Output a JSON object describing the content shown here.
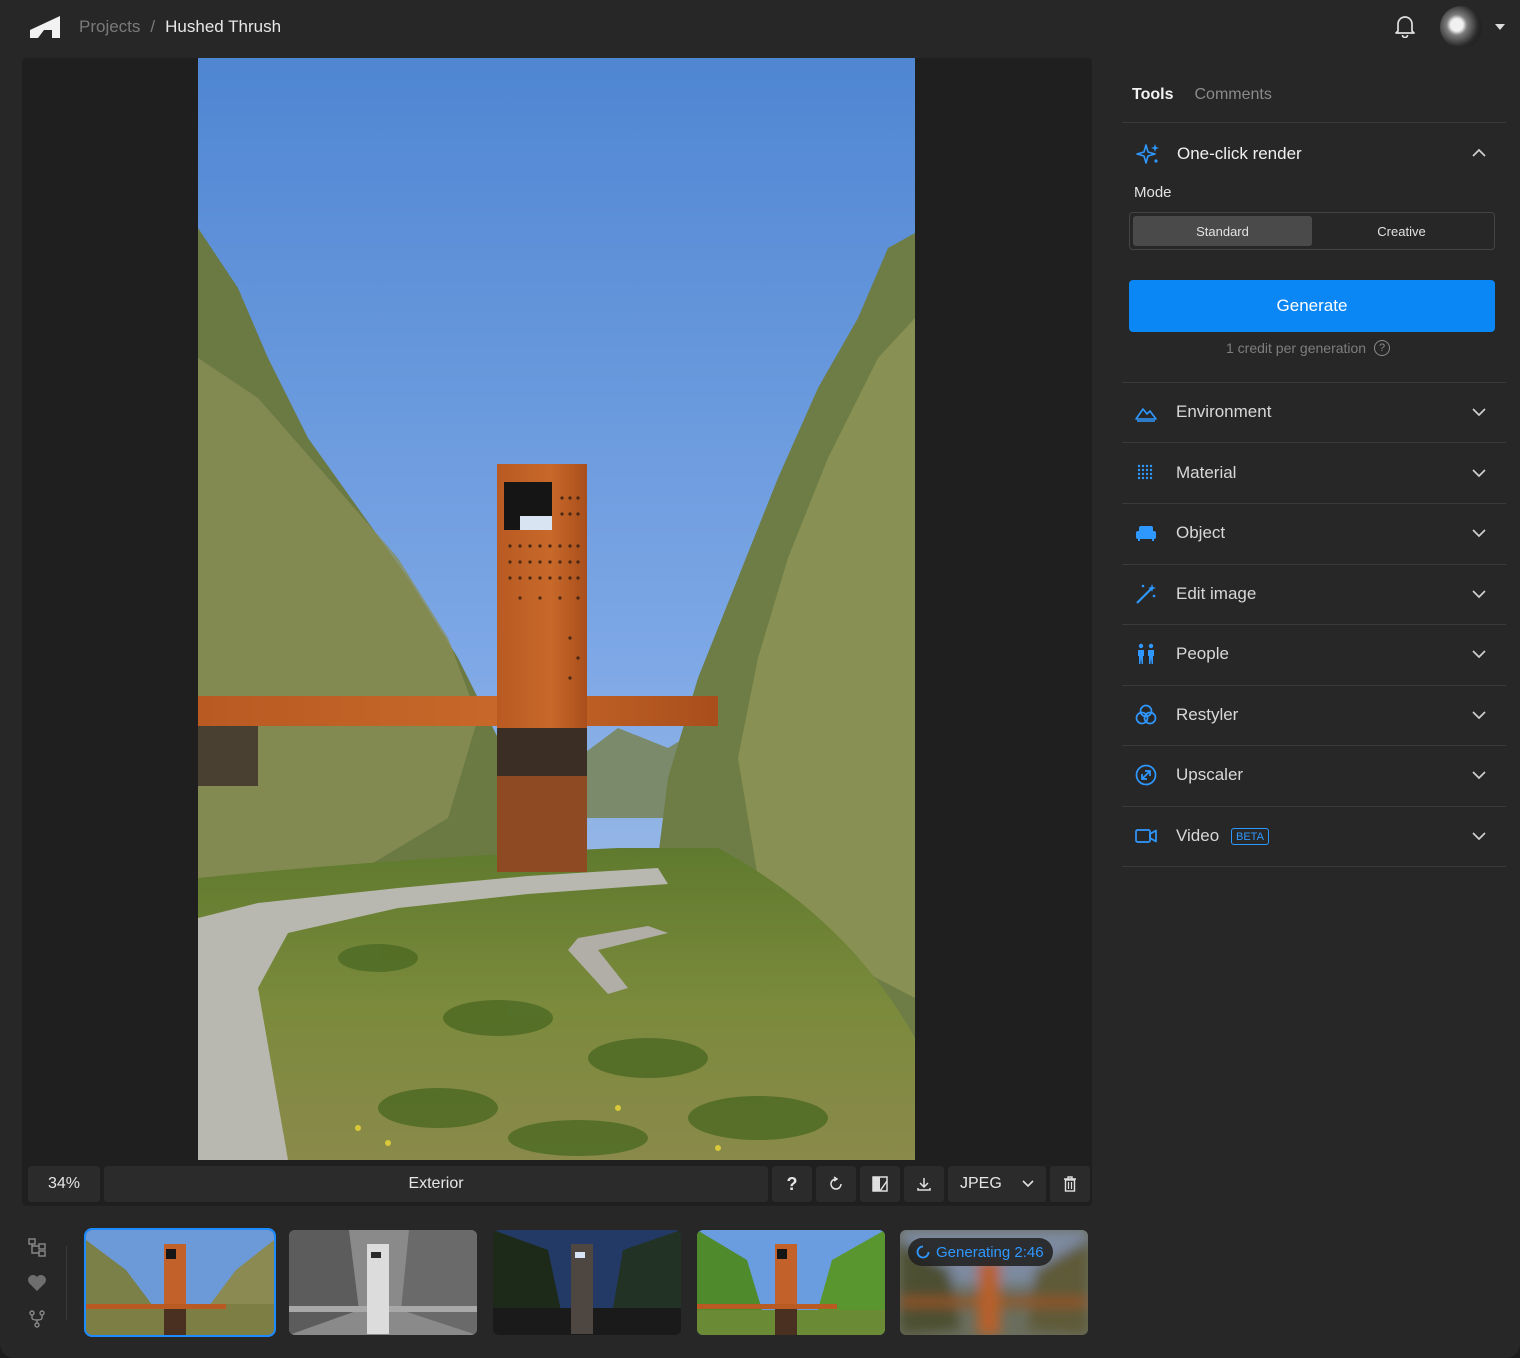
{
  "header": {
    "breadcrumb_root": "Projects",
    "breadcrumb_sep": "/",
    "project_name": "Hushed Thrush"
  },
  "toolbar": {
    "zoom": "34%",
    "image_title": "Exterior",
    "help_label": "?",
    "format": "JPEG"
  },
  "thumbnails": {
    "generating_label": "Generating 2:46"
  },
  "panel": {
    "tabs": [
      {
        "label": "Tools",
        "active": true
      },
      {
        "label": "Comments",
        "active": false
      }
    ],
    "one_click": {
      "title": "One-click render",
      "mode_label": "Mode",
      "modes": [
        {
          "label": "Standard",
          "active": true
        },
        {
          "label": "Creative",
          "active": false
        }
      ],
      "generate_label": "Generate",
      "credit_note": "1 credit per generation"
    },
    "sections": [
      {
        "label": "Environment",
        "icon": "mountain-icon"
      },
      {
        "label": "Material",
        "icon": "grid-dots-icon"
      },
      {
        "label": "Object",
        "icon": "sofa-icon"
      },
      {
        "label": "Edit image",
        "icon": "magic-wand-icon"
      },
      {
        "label": "People",
        "icon": "people-icon"
      },
      {
        "label": "Restyler",
        "icon": "circles-icon"
      },
      {
        "label": "Upscaler",
        "icon": "upscale-icon"
      },
      {
        "label": "Video",
        "icon": "video-icon",
        "badge": "BETA"
      }
    ]
  },
  "colors": {
    "accent": "#0a86f5",
    "accent_text": "#2f98ff",
    "background": "#272727",
    "canvas": "#1f1f1f"
  }
}
